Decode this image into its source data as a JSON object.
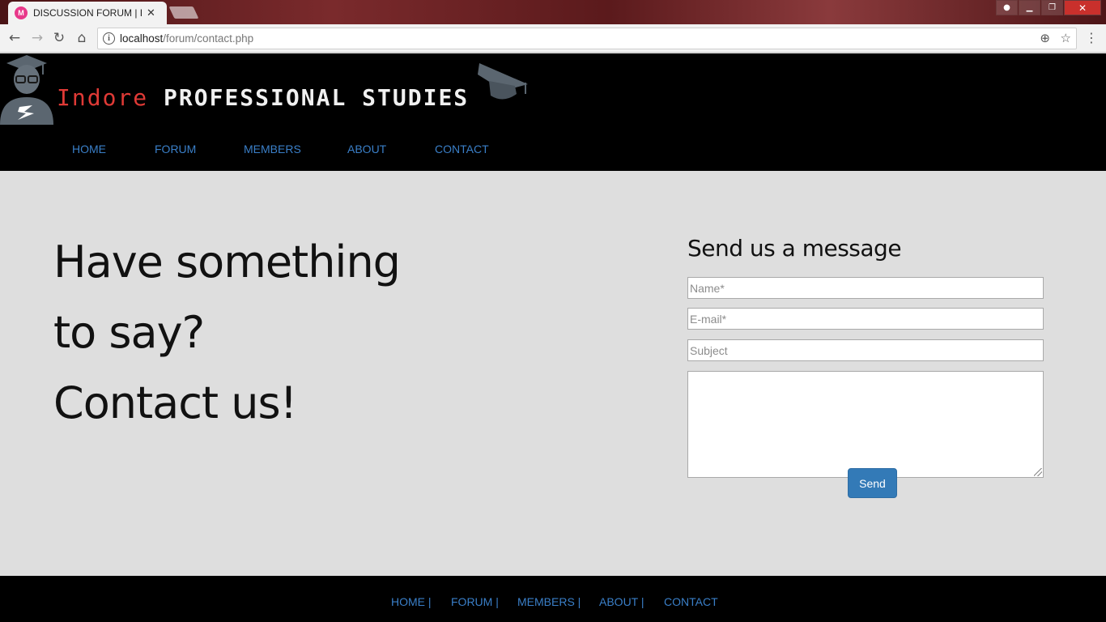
{
  "browser": {
    "tab_title": "DISCUSSION FORUM | IN",
    "tab_favicon_text": "M",
    "url_host": "localhost",
    "url_path": "/forum/contact.php",
    "icons": [
      "back-icon",
      "forward-icon",
      "reload-icon",
      "home-icon",
      "info-icon",
      "zoom-icon",
      "star-icon",
      "menu-icon"
    ]
  },
  "header": {
    "logo_first": "Indore",
    "logo_rest": "PROFESSIONAL STUDIES",
    "nav": [
      "HOME",
      "FORUM",
      "MEMBERS",
      "ABOUT",
      "CONTACT"
    ]
  },
  "main": {
    "headline": [
      "Have something",
      "to say?",
      "Contact us!"
    ],
    "form_title": "Send us a message",
    "name_placeholder": "Name*",
    "email_placeholder": "E-mail*",
    "subject_placeholder": "Subject",
    "message_value": "",
    "send_label": "Send"
  },
  "footer": {
    "nav": [
      "HOME |",
      "FORUM |",
      "MEMBERS |",
      "ABOUT |",
      "CONTACT"
    ]
  },
  "colors": {
    "link": "#3a7fc8",
    "logo_red": "#e03a36",
    "button": "#337ab7",
    "page_bg": "#dedede",
    "header_bg": "#000000"
  }
}
